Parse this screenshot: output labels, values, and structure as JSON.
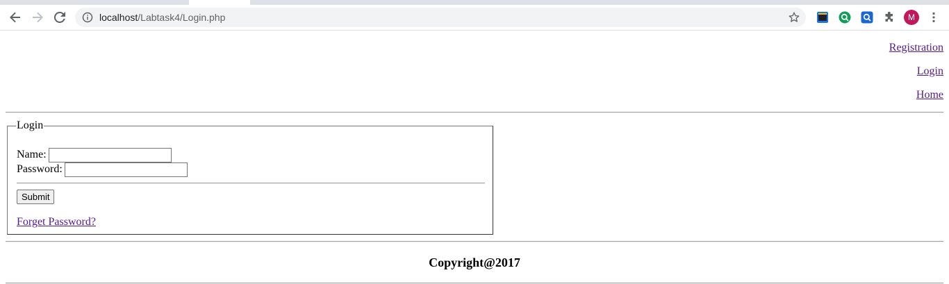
{
  "browser": {
    "url_host": "localhost",
    "url_path": "/Labtask4/Login.php",
    "profile_initial": "M"
  },
  "nav": {
    "registration": "Registration",
    "login": "Login",
    "home": "Home"
  },
  "login_form": {
    "legend": "Login",
    "name_label": "Name:",
    "name_value": "",
    "password_label": "Password:",
    "password_value": "",
    "submit_label": "Submit",
    "forgot_link": "Forget Password?"
  },
  "footer": {
    "copyright": "Copyright@2017"
  },
  "colors": {
    "link_visited": "#551a8b",
    "avatar": "#c2185b",
    "omnibox_bg": "#f1f3f4"
  }
}
